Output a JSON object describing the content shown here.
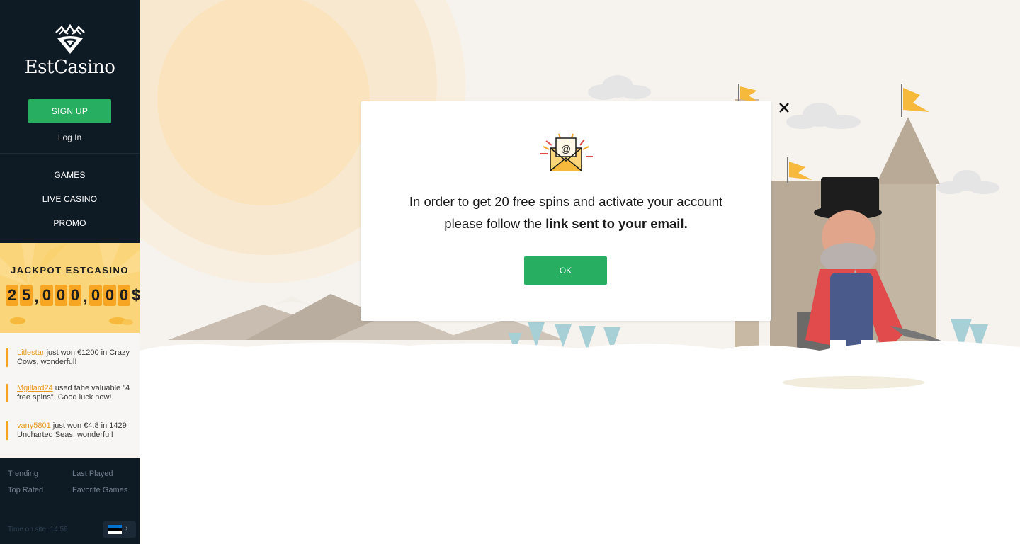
{
  "brand": {
    "name": "EstCasino",
    "logo_icon": "crown-heart-logo-icon"
  },
  "auth": {
    "signup_label": "SIGN UP",
    "login_label": "Log In"
  },
  "nav": [
    {
      "label": "GAMES"
    },
    {
      "label": "LIVE CASINO"
    },
    {
      "label": "PROMO"
    }
  ],
  "jackpot": {
    "title": "JACKPOT ESTCASINO",
    "amount": "25,000,000$",
    "digits": [
      "2",
      "5",
      ",",
      "0",
      "0",
      "0",
      ",",
      "0",
      "0",
      "0",
      "$"
    ]
  },
  "feed": [
    {
      "user": "Litlestar",
      "text1": " just won €1200 in ",
      "game": "Crazy Cows, won",
      "text2": "derful!"
    },
    {
      "user": "Mgillard24",
      "text1": " used tahe valuable \"4 free spins\". Good luck now!",
      "game": "",
      "text2": ""
    },
    {
      "user": "vany5801",
      "text1": " just won €4.8 in 1429 Uncharted Seas, wonderful!",
      "game": "",
      "text2": ""
    }
  ],
  "footer": {
    "trending": "Trending",
    "last_played": "Last Played",
    "top_rated": "Top Rated",
    "favorite_games": "Favorite Games",
    "time_on_site": "Time on site: 14:59",
    "flag_colors": [
      "#0072ce",
      "#000000",
      "#ffffff"
    ]
  },
  "modal": {
    "icon": "email-envelope-icon",
    "text_line1": "In order to get 20 free spins and activate your account",
    "text_line2_prefix": "please follow the ",
    "link_text": "link sent to your email",
    "text_line2_suffix": ".",
    "ok_label": "OK",
    "close_icon": "close-icon"
  },
  "colors": {
    "sidebar": "#0e1a24",
    "accent_green": "#27ae60",
    "jackpot_bg": "#fbd579",
    "orange": "#f6a623"
  }
}
